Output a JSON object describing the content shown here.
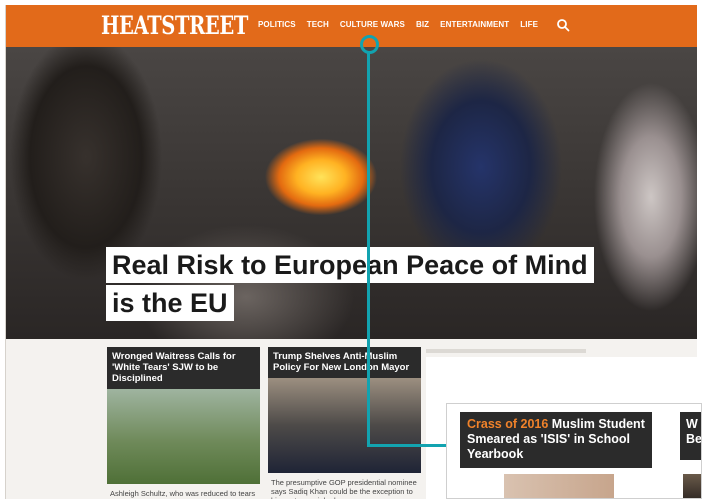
{
  "site": {
    "logo": "HEATSTREET",
    "nav": [
      "POLITICS",
      "TECH",
      "CULTURE WARS",
      "BIZ",
      "ENTERTAINMENT",
      "LIFE"
    ],
    "search_icon": "search-icon"
  },
  "hero": {
    "headline_line1": "Real Risk to European Peace of Mind",
    "headline_line2": "is the EU"
  },
  "cards": [
    {
      "title": "Wronged Waitress Calls for 'White Tears' SJW to be Disciplined",
      "excerpt": "Ashleigh Schultz, who was reduced to tears by Nokuzo Qwabe and a friend, spoke out against her tormentor"
    },
    {
      "title": "Trump Shelves Anti-Muslim Policy For New London Mayor",
      "excerpt": "The presumptive GOP presidential nominee says Sadiq Khan could be the exception to his controversial rule"
    }
  ],
  "callout": {
    "kicker": "Crass of 2016",
    "title": "Muslim Student Smeared as 'ISIS' in School Yearbook",
    "next_title": "W Be"
  },
  "colors": {
    "brand": "#e26a1a",
    "highlight": "#12a3b0",
    "card_title_bg": "#2b2b2b"
  }
}
